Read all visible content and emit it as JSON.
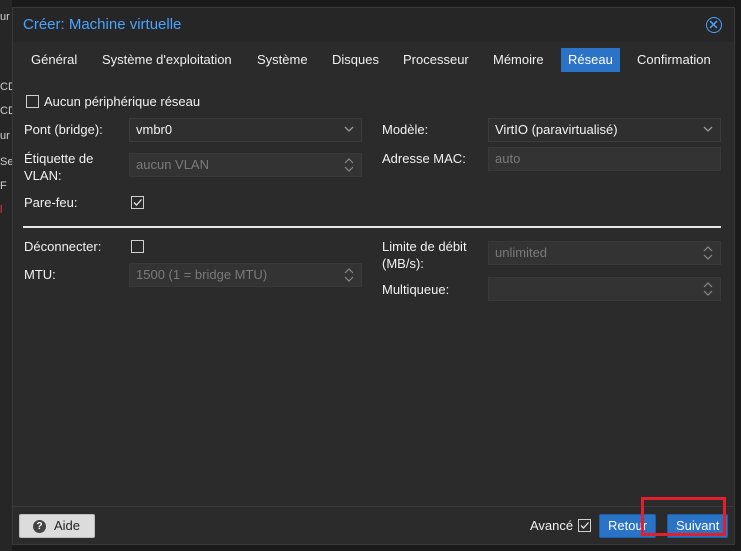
{
  "background": {
    "fragments": [
      "ur",
      "CD",
      "CD",
      "ur",
      "Se",
      "F",
      "l"
    ]
  },
  "window": {
    "title": "Créer: Machine virtuelle",
    "close_icon": "close-circle-icon"
  },
  "tabs": [
    {
      "label": "Général",
      "active": false
    },
    {
      "label": "Système d'exploitation",
      "active": false
    },
    {
      "label": "Système",
      "active": false
    },
    {
      "label": "Disques",
      "active": false
    },
    {
      "label": "Processeur",
      "active": false
    },
    {
      "label": "Mémoire",
      "active": false
    },
    {
      "label": "Réseau",
      "active": true
    },
    {
      "label": "Confirmation",
      "active": false
    }
  ],
  "form": {
    "no_network": {
      "label": "Aucun périphérique réseau",
      "checked": false
    },
    "bridge": {
      "label": "Pont (bridge):",
      "value": "vmbr0"
    },
    "vlan": {
      "label_line1": "Étiquette de",
      "label_line2": "VLAN:",
      "placeholder": "aucun VLAN"
    },
    "firewall": {
      "label": "Pare-feu:",
      "checked": true
    },
    "model": {
      "label": "Modèle:",
      "value": "VirtIO (paravirtualisé)"
    },
    "mac": {
      "label": "Adresse MAC:",
      "placeholder": "auto"
    },
    "disconnect": {
      "label": "Déconnecter:",
      "checked": false
    },
    "mtu": {
      "label": "MTU:",
      "placeholder": "1500 (1 = bridge MTU)"
    },
    "rate_limit": {
      "label_line1": "Limite de débit",
      "label_line2": "(MB/s):",
      "placeholder": "unlimited"
    },
    "multiqueue": {
      "label": "Multiqueue:",
      "value": ""
    }
  },
  "footer": {
    "help_label": "Aide",
    "advanced_label": "Avancé",
    "advanced_checked": true,
    "back_label": "Retour",
    "next_label": "Suivant"
  },
  "colors": {
    "accent": "#2a73c7",
    "title": "#4aa3ff",
    "highlight": "#e0202a"
  }
}
